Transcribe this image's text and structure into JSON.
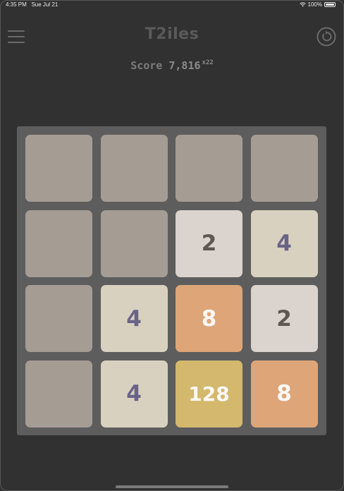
{
  "status_bar": {
    "time": "4:35 PM",
    "date": "Sue Jul 21",
    "battery": "100%",
    "wifi_icon": "wifi-icon",
    "battery_icon": "battery-icon"
  },
  "header": {
    "title": "T2iles",
    "menu_icon": "hamburger-menu-icon",
    "restart_icon": "restart-icon"
  },
  "score": {
    "label": "Score",
    "value": "7,816",
    "multiplier": "x22"
  },
  "board": {
    "rows": 4,
    "cols": 4,
    "tiles": [
      [
        "",
        "",
        "",
        ""
      ],
      [
        "",
        "",
        "2",
        "4"
      ],
      [
        "",
        "4",
        "8",
        "2"
      ],
      [
        "",
        "4",
        "128",
        "8"
      ]
    ]
  },
  "colors": {
    "background": "#313131",
    "board": "#5d5d5d",
    "empty_tile": "#a59c94",
    "tile_2": "#dbd3cd",
    "tile_4": "#d8d1bf",
    "tile_8": "#dea578",
    "tile_128": "#d3b86d"
  }
}
